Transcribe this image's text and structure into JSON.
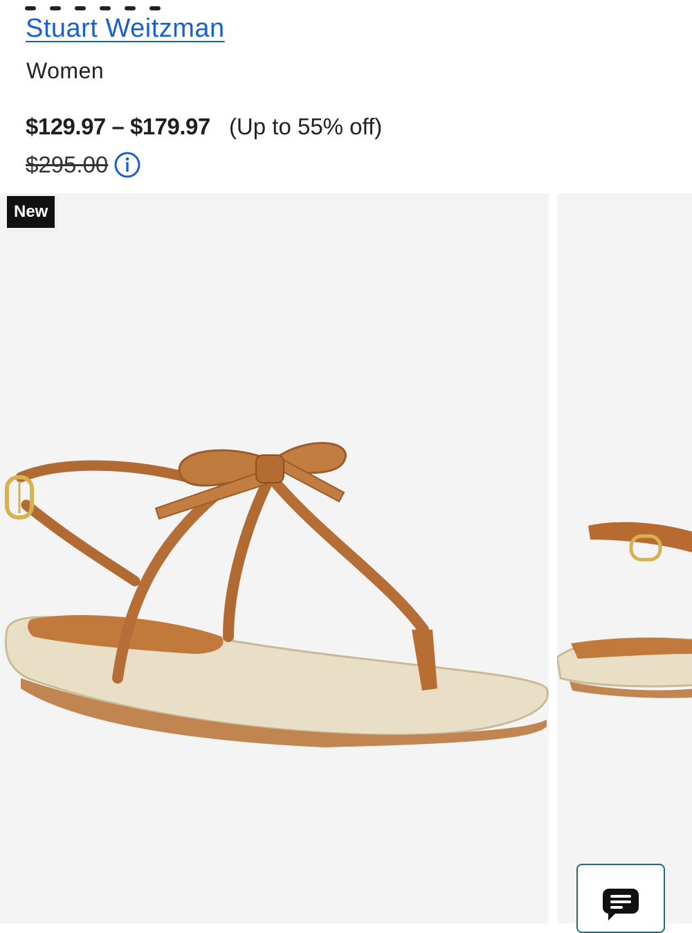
{
  "product": {
    "brand": "Stuart Weitzman",
    "category": "Women",
    "price_range": "$129.97 – $179.97",
    "discount_text": "(Up to 55% off)",
    "original_price": "$295.00"
  },
  "gallery": {
    "badge": "New",
    "images": [
      "bow-thong-sandal-angle",
      "bow-thong-sandal-side"
    ]
  },
  "icons": {
    "info": "info-icon",
    "chat": "chat-icon"
  },
  "colors": {
    "link": "#1a5fd0",
    "badge_bg": "#111111",
    "image_bg": "#f4f4f4",
    "chat_border": "#1e6b87"
  }
}
